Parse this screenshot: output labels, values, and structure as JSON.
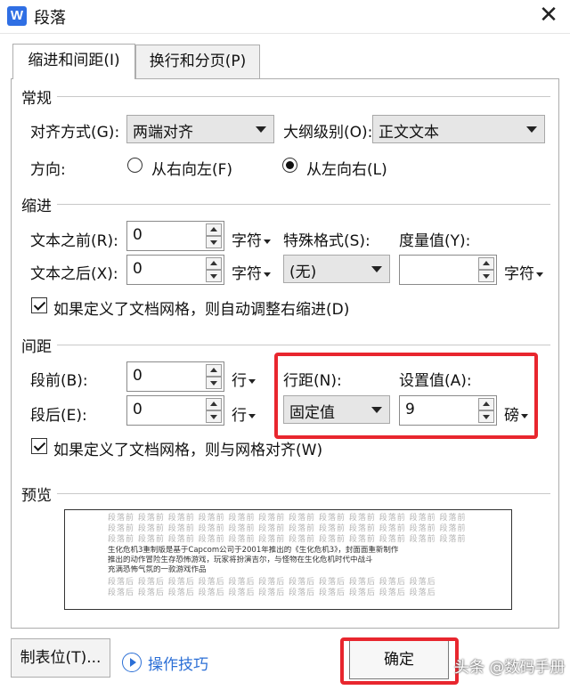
{
  "window": {
    "title": "段落",
    "app_icon": "W",
    "close": "✕"
  },
  "tabs": [
    {
      "label": "缩进和间距(I)",
      "active": true
    },
    {
      "label": "换行和分页(P)",
      "active": false
    }
  ],
  "general": {
    "heading": "常规",
    "alignment": {
      "label": "对齐方式(G):",
      "value": "两端对齐"
    },
    "outline": {
      "label": "大纲级别(O):",
      "value": "正文文本"
    },
    "direction": {
      "label": "方向:",
      "rtl": "从右向左(F)",
      "ltr": "从左向右(L)",
      "selected": "ltr"
    }
  },
  "indent": {
    "heading": "缩进",
    "before": {
      "label": "文本之前(R):",
      "value": "0",
      "unit": "字符"
    },
    "after": {
      "label": "文本之后(X):",
      "value": "0",
      "unit": "字符"
    },
    "special": {
      "label": "特殊格式(S):",
      "value": "(无)"
    },
    "measure": {
      "label": "度量值(Y):",
      "value": "",
      "unit": "字符"
    },
    "auto_adjust": {
      "label": "如果定义了文档网格，则自动调整右缩进(D)",
      "checked": true
    }
  },
  "spacing": {
    "heading": "间距",
    "before": {
      "label": "段前(B):",
      "value": "0",
      "unit": "行"
    },
    "after": {
      "label": "段后(E):",
      "value": "0",
      "unit": "行"
    },
    "line_spacing": {
      "label": "行距(N):",
      "value": "固定值"
    },
    "set_value": {
      "label": "设置值(A):",
      "value": "9",
      "unit": "磅"
    },
    "snap_grid": {
      "label": "如果定义了文档网格，则与网格对齐(W)",
      "checked": true
    }
  },
  "preview": {
    "heading": "预览",
    "filler": "段落前 段落前 段落前 段落前 段落前 段落前 段落前 段落前 段落前 段落前 段落前 段落前",
    "body_lines": [
      "生化危机3重制版是基于Capcom公司于2001年推出的《生化危机3》，封面面重新制作",
      "推出的动作冒险生存恐怖游戏，玩家将扮演吉尔，与怪物在生化危机时代中战斗",
      "充满恐怖气氛的一款游戏作品"
    ],
    "after_filler": "段落后 段落后 段落后 段落后 段落后 段落后 段落后 段落后 段落后 段落后 段落后"
  },
  "footer": {
    "tabs_button": "制表位(T)...",
    "help_link": "操作技巧",
    "ok_button": "确定"
  },
  "watermark": "头条 @数码手册",
  "colors": {
    "highlight": "#e8262e",
    "link": "#2b6fd6",
    "app_icon": "#2f6fe4"
  }
}
